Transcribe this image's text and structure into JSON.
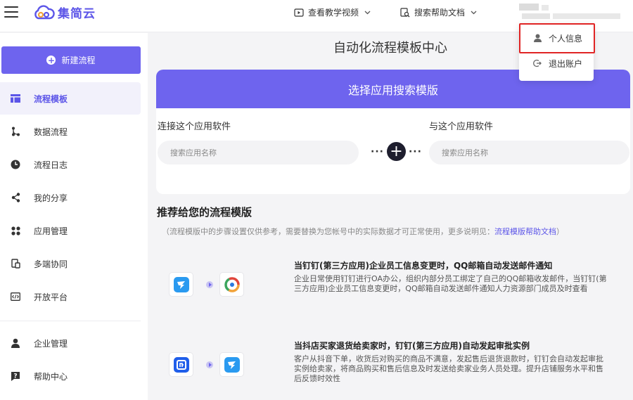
{
  "header": {
    "logo_text": "集简云",
    "nav": [
      {
        "label": "查看教学视频",
        "icon": "video-icon"
      },
      {
        "label": "搜索帮助文档",
        "icon": "doc-search-icon"
      }
    ]
  },
  "sidebar": {
    "new_button": "新建流程",
    "items": [
      {
        "label": "流程模板",
        "icon": "template-icon",
        "active": true
      },
      {
        "label": "数据流程",
        "icon": "flow-icon"
      },
      {
        "label": "流程日志",
        "icon": "clock-icon"
      },
      {
        "label": "我的分享",
        "icon": "share-icon"
      },
      {
        "label": "应用管理",
        "icon": "apps-icon"
      },
      {
        "label": "多端协同",
        "icon": "devices-icon"
      },
      {
        "label": "开放平台",
        "icon": "code-icon"
      },
      {
        "label": "企业管理",
        "icon": "user-icon"
      },
      {
        "label": "帮助中心",
        "icon": "help-icon"
      }
    ]
  },
  "main": {
    "title": "自动化流程模板中心",
    "search_card": {
      "header": "选择应用搜索模版",
      "left_label": "连接这个应用软件",
      "right_label": "与这个应用软件",
      "left_placeholder": "搜索应用名称",
      "right_placeholder": "搜索应用名称"
    },
    "recommend": {
      "title": "推荐给您的流程模版",
      "note": "（流程模版中的步骤设置仅供参考，需要替换为您帐号中的实际数据才可正常使用，更多说明见：",
      "note_link": "流程模版帮助文档",
      "note_end": "）"
    },
    "templates": [
      {
        "title": "当钉钉(第三方应用)企业员工信息变更时，QQ邮箱自动发送邮件通知",
        "desc": "企业日常使用钉钉进行OA办公，组织内部分员工绑定了自己的QQ邮箱收发邮件，当钉钉(第三方应用)企业员工信息变更时，QQ邮箱自动发送邮件通知人力资源部门成员及时查看",
        "from_icon": "dingtalk-icon",
        "to_icon": "qqmail-icon"
      },
      {
        "title": "当抖店买家退货给卖家时，钉钉(第三方应用)自动发起审批实例",
        "desc": "客户从抖音下单，收货后对购买的商品不满意，发起售后退货退款时，钉钉会自动发起审批实例给卖家，将商品购买和售后信息及时发送给卖家业务人员处理。提升店铺服务水平和售后反馈时效性",
        "from_icon": "doudian-icon",
        "to_icon": "dingtalk-icon"
      }
    ]
  },
  "dropdown": {
    "items": [
      {
        "label": "个人信息",
        "icon": "person-icon"
      },
      {
        "label": "退出账户",
        "icon": "logout-icon"
      }
    ]
  },
  "colors": {
    "accent": "#6e64ee",
    "highlight": "#e02424"
  }
}
